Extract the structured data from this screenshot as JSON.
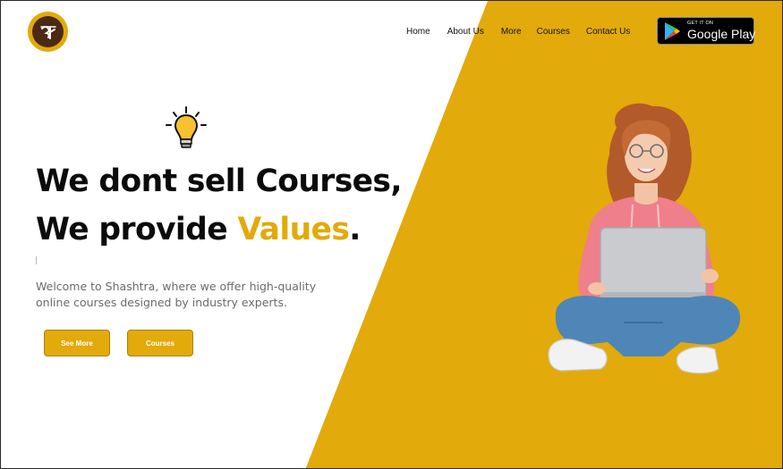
{
  "brand": {
    "logo_glyph": "श्र",
    "logo_color": "#e2aa0a",
    "logo_inner_color": "#4a2a14"
  },
  "nav": {
    "items": [
      "Home",
      "About Us",
      "More",
      "Courses",
      "Contact Us"
    ]
  },
  "google_play": {
    "small_text": "GET IT ON",
    "big_text": "Google Play"
  },
  "hero": {
    "line1": "We dont sell Courses,",
    "line2_prefix": "We provide ",
    "line2_accent": "Values",
    "line2_suffix": ".",
    "description": "Welcome to Shashtra, where we offer high-quality online courses designed by industry experts.",
    "icon": "lightbulb-icon"
  },
  "buttons": {
    "see_more": "See More",
    "courses": "Courses"
  },
  "colors": {
    "accent": "#e2aa0a",
    "text_dark": "#0b0b0b",
    "text_muted": "#6b6b6b"
  }
}
